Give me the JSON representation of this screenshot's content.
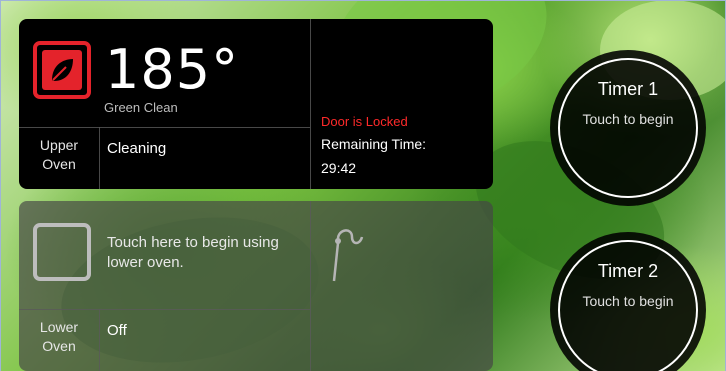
{
  "upper_oven": {
    "temperature": "185°",
    "mode": "Green Clean",
    "label_line1": "Upper",
    "label_line2": "Oven",
    "status": "Cleaning",
    "door_status": "Door is Locked",
    "remaining_label": "Remaining Time:",
    "remaining_value": "29:42",
    "icon": "leaf-icon",
    "accent_color": "#e4232b"
  },
  "lower_oven": {
    "hint": "Touch here to begin using lower oven.",
    "label_line1": "Lower",
    "label_line2": "Oven",
    "status": "Off",
    "icon": "probe-icon"
  },
  "timers": [
    {
      "title": "Timer 1",
      "subtitle": "Touch to begin"
    },
    {
      "title": "Timer 2",
      "subtitle": "Touch to begin"
    }
  ]
}
